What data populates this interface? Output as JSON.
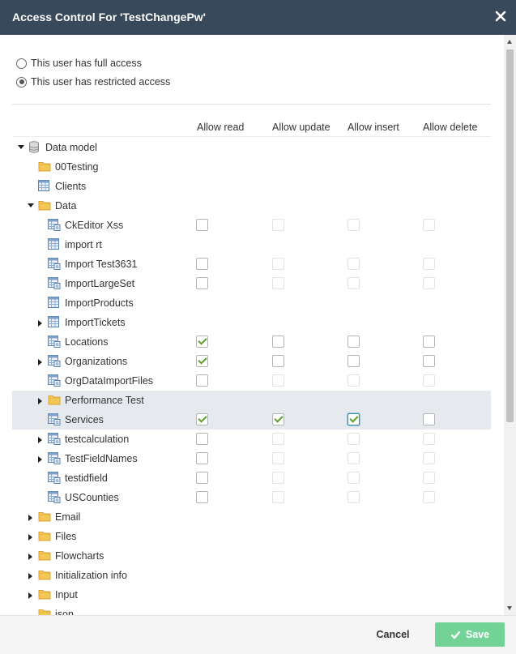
{
  "dialog": {
    "title": "Access Control For 'TestChangePw'"
  },
  "access_options": [
    {
      "label": "This user has full access",
      "selected": false
    },
    {
      "label": "This user has restricted access",
      "selected": true
    }
  ],
  "columns": [
    "Allow read",
    "Allow update",
    "Allow insert",
    "Allow delete"
  ],
  "tree": [
    {
      "label": "Data model",
      "icon": "database",
      "depth": 0,
      "toggle": "expanded",
      "perms": null
    },
    {
      "label": "00Testing",
      "icon": "folder",
      "depth": 1,
      "toggle": "none",
      "perms": null
    },
    {
      "label": "Clients",
      "icon": "table",
      "depth": 1,
      "toggle": "none",
      "perms": null
    },
    {
      "label": "Data",
      "icon": "folder",
      "depth": 1,
      "toggle": "expanded",
      "perms": null
    },
    {
      "label": "CkEditor Xss",
      "icon": "form",
      "depth": 2,
      "toggle": "none",
      "perms": [
        {
          "checked": false,
          "enabled": true
        },
        {
          "checked": false,
          "enabled": false
        },
        {
          "checked": false,
          "enabled": false
        },
        {
          "checked": false,
          "enabled": false
        }
      ]
    },
    {
      "label": "import rt",
      "icon": "table",
      "depth": 2,
      "toggle": "none",
      "perms": null
    },
    {
      "label": "Import Test3631",
      "icon": "form",
      "depth": 2,
      "toggle": "none",
      "perms": [
        {
          "checked": false,
          "enabled": true
        },
        {
          "checked": false,
          "enabled": false
        },
        {
          "checked": false,
          "enabled": false
        },
        {
          "checked": false,
          "enabled": false
        }
      ]
    },
    {
      "label": "ImportLargeSet",
      "icon": "form",
      "depth": 2,
      "toggle": "none",
      "perms": [
        {
          "checked": false,
          "enabled": true
        },
        {
          "checked": false,
          "enabled": false
        },
        {
          "checked": false,
          "enabled": false
        },
        {
          "checked": false,
          "enabled": false
        }
      ]
    },
    {
      "label": "ImportProducts",
      "icon": "table",
      "depth": 2,
      "toggle": "none",
      "perms": null
    },
    {
      "label": "ImportTickets",
      "icon": "table",
      "depth": 2,
      "toggle": "collapsed",
      "perms": null
    },
    {
      "label": "Locations",
      "icon": "form",
      "depth": 2,
      "toggle": "none",
      "perms": [
        {
          "checked": true,
          "enabled": true
        },
        {
          "checked": false,
          "enabled": true
        },
        {
          "checked": false,
          "enabled": true
        },
        {
          "checked": false,
          "enabled": true
        }
      ]
    },
    {
      "label": "Organizations",
      "icon": "form",
      "depth": 2,
      "toggle": "collapsed",
      "perms": [
        {
          "checked": true,
          "enabled": true
        },
        {
          "checked": false,
          "enabled": true
        },
        {
          "checked": false,
          "enabled": true
        },
        {
          "checked": false,
          "enabled": true
        }
      ]
    },
    {
      "label": "OrgDataImportFiles",
      "icon": "form",
      "depth": 2,
      "toggle": "none",
      "perms": [
        {
          "checked": false,
          "enabled": true
        },
        {
          "checked": false,
          "enabled": false
        },
        {
          "checked": false,
          "enabled": false
        },
        {
          "checked": false,
          "enabled": false
        }
      ]
    },
    {
      "label": "Performance Test",
      "icon": "folder",
      "depth": 2,
      "toggle": "collapsed",
      "perms": null,
      "highlight": true
    },
    {
      "label": "Services",
      "icon": "form",
      "depth": 2,
      "toggle": "none",
      "perms": [
        {
          "checked": true,
          "enabled": true
        },
        {
          "checked": true,
          "enabled": true
        },
        {
          "checked": true,
          "enabled": true,
          "focused": true
        },
        {
          "checked": false,
          "enabled": true
        }
      ],
      "highlight": true
    },
    {
      "label": "testcalculation",
      "icon": "form",
      "depth": 2,
      "toggle": "collapsed",
      "perms": [
        {
          "checked": false,
          "enabled": true
        },
        {
          "checked": false,
          "enabled": false
        },
        {
          "checked": false,
          "enabled": false
        },
        {
          "checked": false,
          "enabled": false
        }
      ]
    },
    {
      "label": "TestFieldNames",
      "icon": "form",
      "depth": 2,
      "toggle": "collapsed",
      "perms": [
        {
          "checked": false,
          "enabled": true
        },
        {
          "checked": false,
          "enabled": false
        },
        {
          "checked": false,
          "enabled": false
        },
        {
          "checked": false,
          "enabled": false
        }
      ]
    },
    {
      "label": "testidfield",
      "icon": "form",
      "depth": 2,
      "toggle": "none",
      "perms": [
        {
          "checked": false,
          "enabled": true
        },
        {
          "checked": false,
          "enabled": false
        },
        {
          "checked": false,
          "enabled": false
        },
        {
          "checked": false,
          "enabled": false
        }
      ]
    },
    {
      "label": "USCounties",
      "icon": "form",
      "depth": 2,
      "toggle": "none",
      "perms": [
        {
          "checked": false,
          "enabled": true
        },
        {
          "checked": false,
          "enabled": false
        },
        {
          "checked": false,
          "enabled": false
        },
        {
          "checked": false,
          "enabled": false
        }
      ]
    },
    {
      "label": "Email",
      "icon": "folder",
      "depth": 1,
      "toggle": "collapsed",
      "perms": null
    },
    {
      "label": "Files",
      "icon": "folder",
      "depth": 1,
      "toggle": "collapsed",
      "perms": null
    },
    {
      "label": "Flowcharts",
      "icon": "folder",
      "depth": 1,
      "toggle": "collapsed",
      "perms": null
    },
    {
      "label": "Initialization info",
      "icon": "folder",
      "depth": 1,
      "toggle": "collapsed",
      "perms": null
    },
    {
      "label": "Input",
      "icon": "folder",
      "depth": 1,
      "toggle": "collapsed",
      "perms": null
    },
    {
      "label": "json",
      "icon": "folder",
      "depth": 1,
      "toggle": "none",
      "perms": null
    }
  ],
  "footer": {
    "cancel_label": "Cancel",
    "save_label": "Save"
  },
  "colors": {
    "header_bg": "#37495a",
    "save_bg": "#73d397",
    "check_green": "#5aa02c",
    "folder_yellow": "#f3c754",
    "highlight_row": "#e6e9ee"
  }
}
